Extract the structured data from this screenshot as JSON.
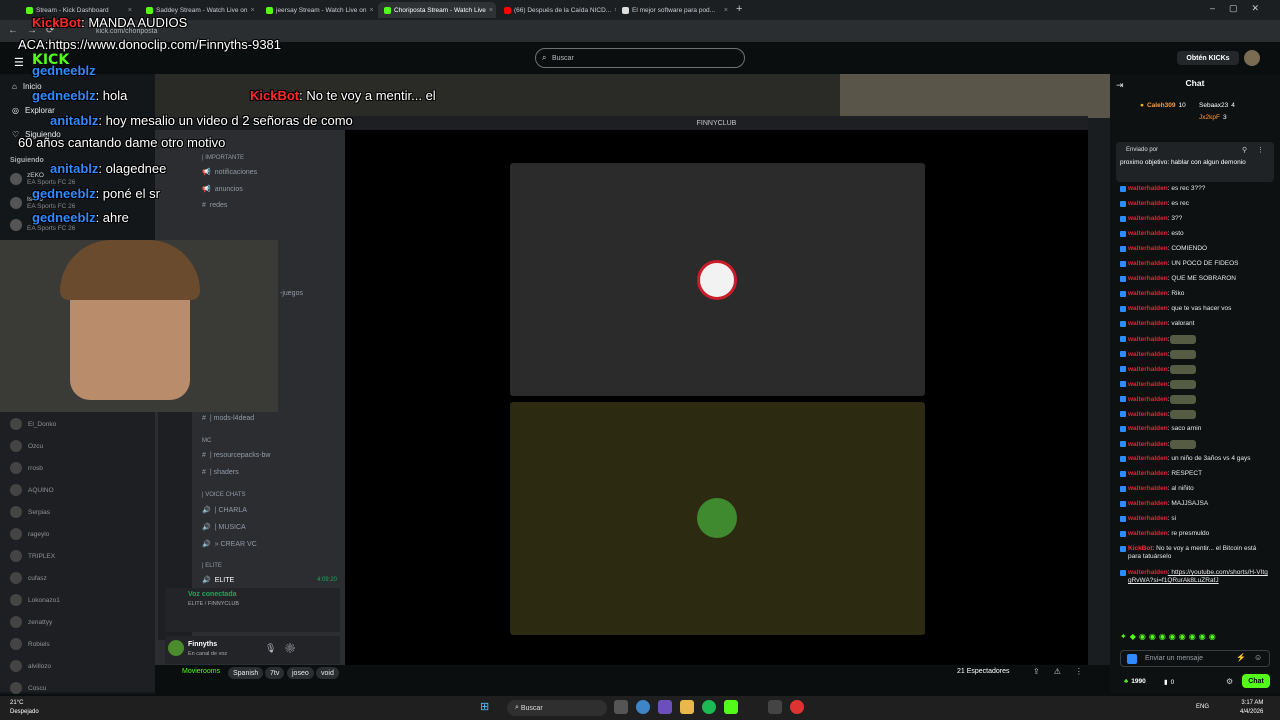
{
  "browser": {
    "tabs": [
      {
        "label": "Stream - Kick Dashboard"
      },
      {
        "label": "Saddey Stream - Watch Live on"
      },
      {
        "label": "jeersay Stream - Watch Live on"
      },
      {
        "label": "Choriposta Stream - Watch Live"
      },
      {
        "label": "(66) Después de la Caída NICD..."
      },
      {
        "label": "El mejor software para pod..."
      }
    ],
    "url": "kick.com/choriposta"
  },
  "header": {
    "search_placeholder": "Buscar",
    "get_kicks": "Obtén KICKs"
  },
  "sidebar": {
    "items": [
      {
        "label": "Inicio"
      },
      {
        "label": "Explorar"
      },
      {
        "label": "Siguiendo"
      }
    ],
    "following_title": "Siguiendo",
    "following": [
      {
        "name": "zEKO",
        "game": "EA Sports FC 26"
      },
      {
        "name": "Isidro",
        "game": "EA Sports FC 26"
      },
      {
        "name": "",
        "game": "EA Sports FC 26"
      }
    ]
  },
  "overlay": {
    "line1_user": "KickBot",
    "line1_text": ": MANDA AUDIOS",
    "line2": "ACA:https://www.donoclip.com/Finnyths-9381",
    "line3_user": "gedneeblz",
    "line4_user": "gedneeblz",
    "line4_text": ": hola",
    "line5_user": "anitablz",
    "line5_text": ": hoy mesalio un video d 2 señoras de como",
    "line6": "60 años cantando dame otro motivo",
    "line7_user": "anitablz",
    "line7_text": ": olagednee",
    "line8_user": "gedneeblz",
    "line8_text": ": poné el sr",
    "line9_user": "gedneeblz",
    "line9_text": ": ahre",
    "line10_user": "KickBot",
    "line10_text": ": No te voy a mentir... el"
  },
  "discord": {
    "window_title": "FINNYCLUB",
    "categories": {
      "importante": "| IMPORTANTE",
      "mc": "MC",
      "voice": "| VOICE CHATS",
      "elite": "| ELITE"
    },
    "channels": [
      {
        "name": "notificaciones"
      },
      {
        "name": "anuncios"
      },
      {
        "name": "redes"
      },
      {
        "name": "| mods-l4dead"
      },
      {
        "name": "| resourcepacks-bw"
      },
      {
        "name": "| shaders"
      },
      {
        "name": "| CHARLA"
      },
      {
        "name": "| MUSICA"
      },
      {
        "name": "» CREAR VC"
      }
    ],
    "elite_voice": {
      "name": "ELITE",
      "timer": "4:09:20"
    },
    "voice_status": {
      "title": "Voz conectada",
      "subtitle": "ELITE / FINNYCLUB"
    },
    "user": {
      "name": "Finnyths",
      "status": "En canal de voz"
    },
    "members": [
      "El_Donko",
      "Ozcu",
      "rrosb",
      "AQUINO",
      "Serpias",
      "rageylo",
      "TRIPLEX",
      "cufasz",
      "Lokonazo1",
      "zenattyy",
      "Robiels",
      "alvillozo",
      "Coscu"
    ],
    "juegos": "-juegos"
  },
  "stream": {
    "category": "Movierooms",
    "tags": [
      "Spanish",
      "7tv",
      "joseo",
      "void"
    ],
    "viewers": "21 Espectadores"
  },
  "chat": {
    "title": "Chat",
    "gifters": [
      {
        "name": "Caleh309",
        "count": "10"
      },
      {
        "name": "Sebaax23",
        "count": "4"
      },
      {
        "name": "Jx2kpF",
        "count": "3"
      }
    ],
    "pinned": {
      "by": "Enviado por",
      "text": "proximo objetivo: hablar con algun demonio"
    },
    "messages": [
      {
        "user": "walterhalden",
        "text": ": es rec 3???"
      },
      {
        "user": "walterhalden",
        "text": ": es rec"
      },
      {
        "user": "walterhalden",
        "text": ": 3??"
      },
      {
        "user": "walterhalden",
        "text": ": esto"
      },
      {
        "user": "walterhalden",
        "text": ": COMIENDO"
      },
      {
        "user": "walterhalden",
        "text": ": UN POCO DE FIDEOS"
      },
      {
        "user": "walterhalden",
        "text": ": QUE ME SOBRARON"
      },
      {
        "user": "walterhalden",
        "text": ": Riko"
      },
      {
        "user": "walterhalden",
        "text": ": que te vas hacer vos"
      },
      {
        "user": "walterhalden",
        "text": ": valorant"
      },
      {
        "user": "walterhalden",
        "text": ":"
      },
      {
        "user": "walterhalden",
        "text": ":"
      },
      {
        "user": "walterhalden",
        "text": ":"
      },
      {
        "user": "walterhalden",
        "text": ":"
      },
      {
        "user": "walterhalden",
        "text": ":"
      },
      {
        "user": "walterhalden",
        "text": ":"
      },
      {
        "user": "walterhalden",
        "text": ": saco arnin"
      },
      {
        "user": "walterhalden",
        "text": ":"
      },
      {
        "user": "walterhalden",
        "text": ": un niño de 3años vs 4 gays"
      },
      {
        "user": "walterhalden",
        "text": ": RESPECT"
      },
      {
        "user": "walterhalden",
        "text": ": al niñito"
      },
      {
        "user": "walterhalden",
        "text": ": MAJJSAJSA"
      },
      {
        "user": "walterhalden",
        "text": ": si"
      },
      {
        "user": "walterhalden",
        "text": ": re presmuldo"
      },
      {
        "user": "KickBot",
        "text": ": No te voy a mentir... el Bitcoin está para tatuárselo"
      },
      {
        "user": "walterhalden",
        "text": ": https://youtube.com/shorts/H-VItggRvWA?si=f1QRurAk8LuZRafJ"
      }
    ],
    "input_placeholder": "Enviar un mensaje",
    "points": "1990",
    "kicks": "0",
    "send_label": "Chat"
  },
  "taskbar": {
    "weather_temp": "21°C",
    "weather_desc": "Despejado",
    "search": "Buscar",
    "lang": "ENG",
    "time": "3:17 AM",
    "date": "4/4/2026"
  },
  "colors": {
    "kick_green": "#53fc18",
    "username_red": "#e02236",
    "badge_blue": "#2f8bff"
  }
}
